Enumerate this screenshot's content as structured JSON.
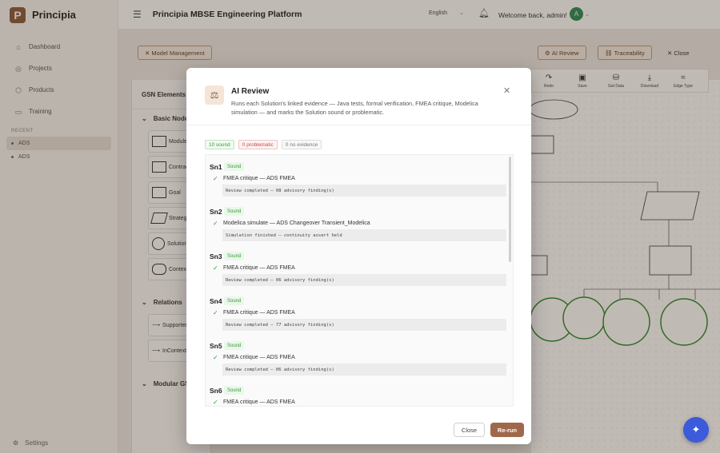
{
  "app": {
    "name": "Principia",
    "logo_letter": "P",
    "platform_title": "Principia MBSE Engineering Platform"
  },
  "topbar": {
    "language": "English",
    "welcome": "Welcome back, admin!",
    "avatar_letter": "A"
  },
  "sidebar": {
    "items": [
      {
        "label": "Dashboard",
        "icon": "home-icon"
      },
      {
        "label": "Projects",
        "icon": "globe-icon"
      },
      {
        "label": "Products",
        "icon": "cube-icon"
      },
      {
        "label": "Training",
        "icon": "book-icon"
      }
    ],
    "recent_label": "RECENT",
    "recent": [
      {
        "label": "ADS"
      },
      {
        "label": "ADS"
      }
    ],
    "settings": "Settings"
  },
  "page_buttons": {
    "model_management": "Model Management",
    "ai_review": "AI Review",
    "traceability": "Traceability",
    "close": "Close"
  },
  "palette": {
    "title": "GSN Elements",
    "basic_nodes": "Basic Nodes",
    "items": [
      "Module",
      "Contract",
      "Goal",
      "Strategy",
      "Solution",
      "Context"
    ],
    "relations": "Relations",
    "relation_items": [
      "SupportedBy",
      "InContextOf"
    ],
    "modular": "Modular GSN"
  },
  "canvas_toolbar": [
    "Redo",
    "Save",
    "Get Data",
    "Download",
    "Edge Type"
  ],
  "modal": {
    "title": "AI Review",
    "description": "Runs each Solution's linked evidence — Java tests, formal verification, FMEA critique, Modelica simulation — and marks the Solution sound or problematic.",
    "summary": {
      "sound": "10 sound",
      "problematic": "0 problematic",
      "no_evidence": "0 no evidence"
    },
    "results": [
      {
        "id": "Sn1",
        "status": "Sound",
        "source": "FMEA critique — ADS FMEA",
        "log": "Review completed — 08 advisory finding(s)"
      },
      {
        "id": "Sn2",
        "status": "Sound",
        "source": "Modelica simulate — ADS Changeover Transient_Modelica",
        "log": "Simulation finished — continuity assert held"
      },
      {
        "id": "Sn3",
        "status": "Sound",
        "source": "FMEA critique — ADS FMEA",
        "log": "Review completed — 06 advisory finding(s)"
      },
      {
        "id": "Sn4",
        "status": "Sound",
        "source": "FMEA critique — ADS FMEA",
        "log": "Review completed — 77 advisory finding(s)"
      },
      {
        "id": "Sn5",
        "status": "Sound",
        "source": "FMEA critique — ADS FMEA",
        "log": "Review completed — 06 advisory finding(s)"
      },
      {
        "id": "Sn6",
        "status": "Sound",
        "source": "FMEA critique — ADS FMEA",
        "log": ""
      }
    ],
    "close_label": "Close",
    "rerun_label": "Re-run"
  }
}
